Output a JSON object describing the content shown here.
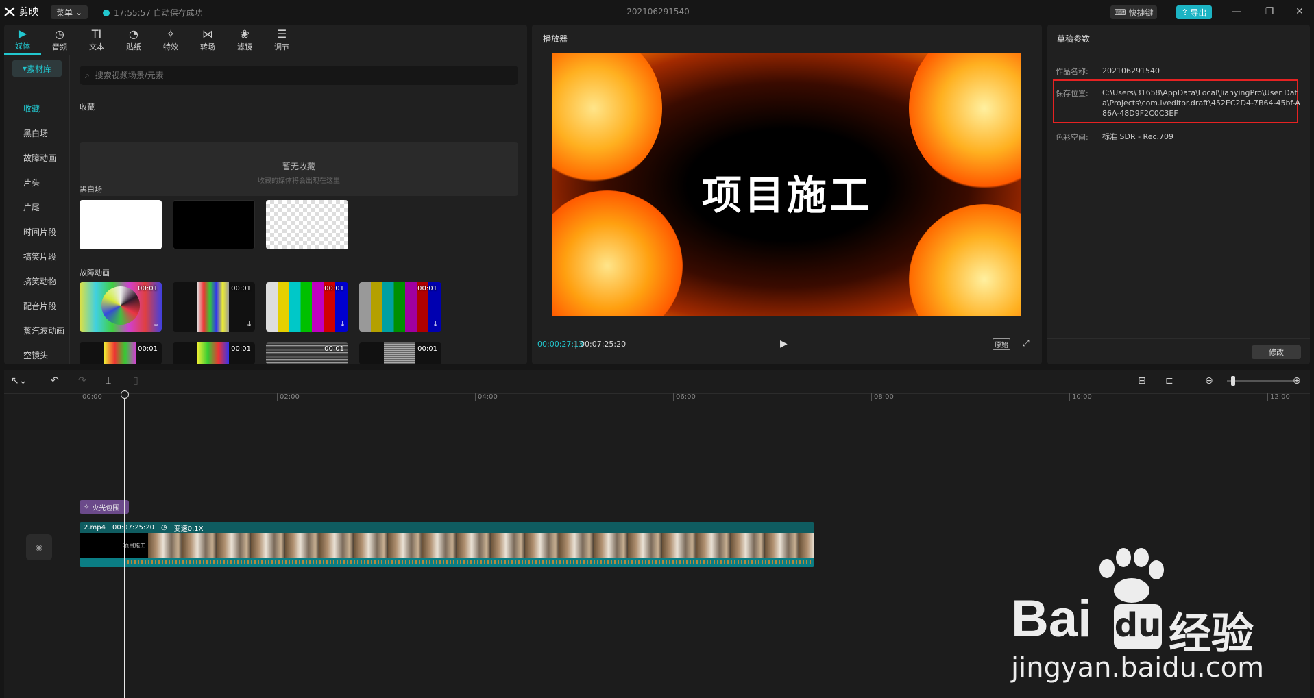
{
  "app": {
    "name": "剪映",
    "menu_label": "菜单",
    "save_status": "17:55:57 自动保存成功",
    "project_title": "202106291540",
    "shortcut_label": "快捷键",
    "export_label": "导出"
  },
  "tools": [
    {
      "label": "媒体",
      "icon": "media-icon"
    },
    {
      "label": "音频",
      "icon": "audio-icon"
    },
    {
      "label": "文本",
      "icon": "text-icon"
    },
    {
      "label": "贴纸",
      "icon": "sticker-icon"
    },
    {
      "label": "特效",
      "icon": "effects-icon"
    },
    {
      "label": "转场",
      "icon": "transition-icon"
    },
    {
      "label": "滤镜",
      "icon": "filter-icon"
    },
    {
      "label": "调节",
      "icon": "adjust-icon"
    }
  ],
  "sidebar": {
    "library_label": "素材库",
    "items": [
      "收藏",
      "黑白场",
      "故障动画",
      "片头",
      "片尾",
      "时间片段",
      "搞笑片段",
      "搞笑动物",
      "配音片段",
      "蒸汽波动画",
      "空镜头"
    ]
  },
  "search": {
    "placeholder": "搜索视频场景/元素"
  },
  "favorites": {
    "title": "收藏",
    "empty_title": "暂无收藏",
    "empty_hint": "收藏的媒体将会出现在这里"
  },
  "bw_section": {
    "title": "黑白场"
  },
  "glitch_section": {
    "title": "故障动画",
    "durations": [
      "00:01",
      "00:01",
      "00:01",
      "00:01",
      "00:01",
      "00:01",
      "00:01",
      "00:01"
    ]
  },
  "player": {
    "title": "播放器",
    "overlay_text": "项目施工",
    "current_time": "00:00:27:13",
    "total_time": "00:07:25:20",
    "original_label": "原始"
  },
  "draft": {
    "title": "草稿参数",
    "name_label": "作品名称:",
    "name_value": "202106291540",
    "path_label": "保存位置:",
    "path_value": "C:\\Users\\31658\\AppData\\Local\\JianyingPro\\User Data\\Projects\\com.lveditor.draft\\452EC2D4-7B64-45bf-A86A-48D9F2C0C3EF",
    "color_label": "色彩空间:",
    "color_value": "标准 SDR - Rec.709",
    "modify_label": "修改"
  },
  "timeline": {
    "ticks": [
      "00:00",
      "02:00",
      "04:00",
      "06:00",
      "08:00",
      "10:00",
      "12:00"
    ],
    "fx_clip_label": "火光包围",
    "main_clip": {
      "file": "2.mp4",
      "duration": "00:07:25:20",
      "speed": "变速0.1X",
      "thumb_text": "项目施工"
    }
  },
  "watermark": {
    "brand": "Bai",
    "brand2": "du",
    "cn": "经验",
    "url": "jingyan.baidu.com"
  },
  "colors": {
    "accent": "#22c7cf",
    "highlight": "#e52222",
    "fx_clip": "#6b4a8a",
    "main_clip": "#0f6d72"
  }
}
